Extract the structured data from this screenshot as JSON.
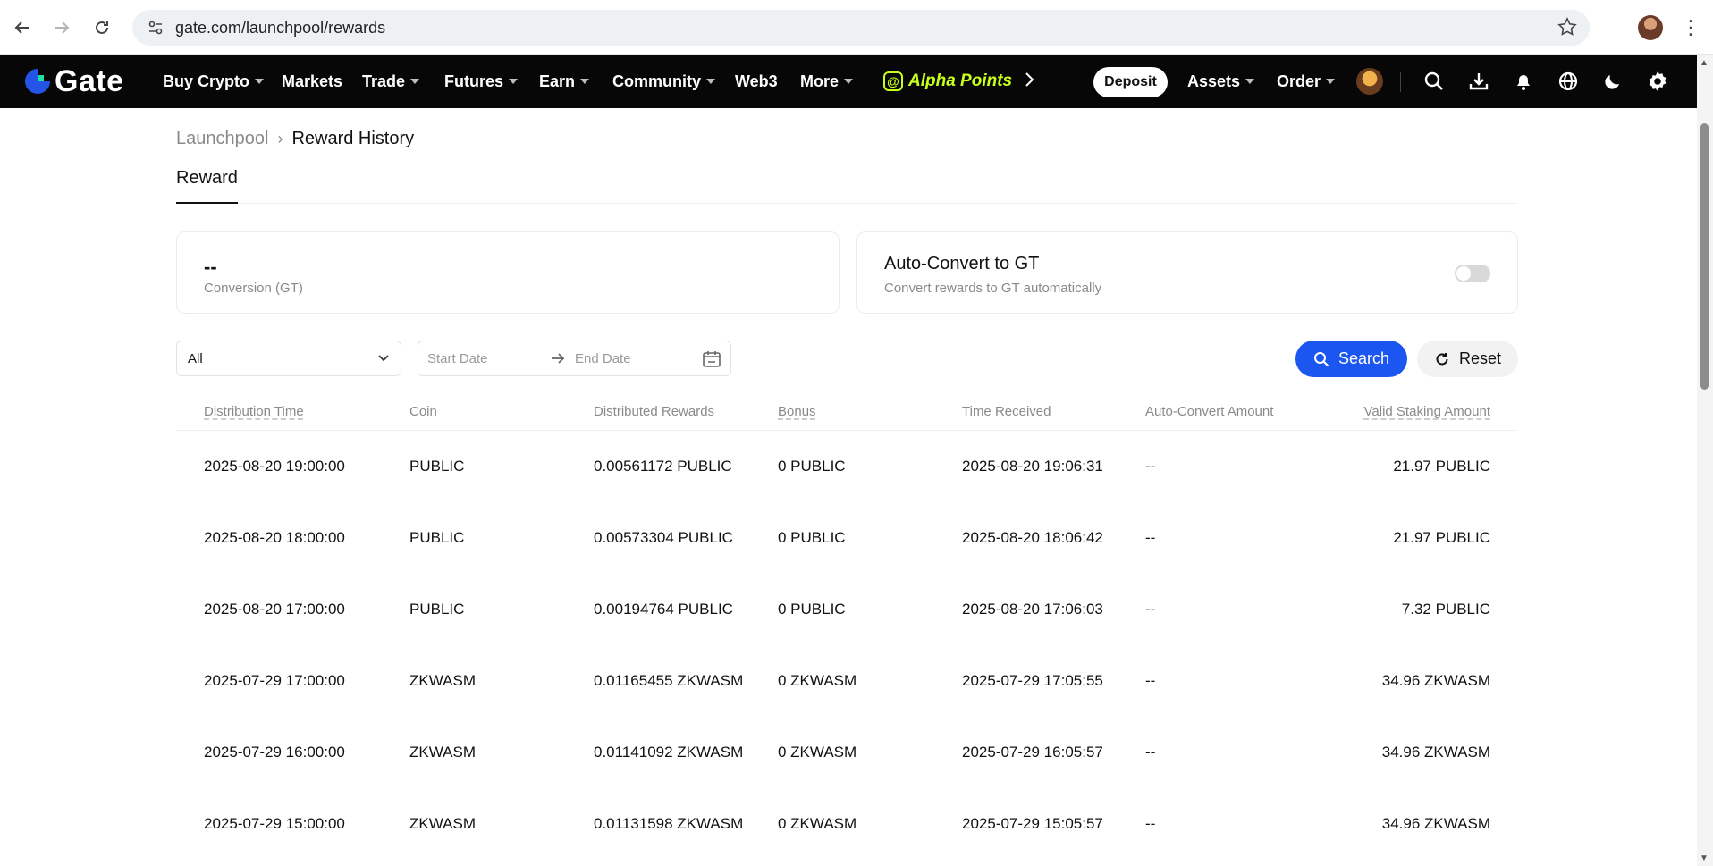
{
  "browser": {
    "url": "gate.com/launchpool/rewards"
  },
  "header": {
    "logo_text": "Gate",
    "nav": [
      {
        "label": "Buy Crypto",
        "caret": true
      },
      {
        "label": "Markets",
        "caret": false
      },
      {
        "label": "Trade",
        "caret": true
      },
      {
        "label": "Futures",
        "caret": true
      },
      {
        "label": "Earn",
        "caret": true
      },
      {
        "label": "Community",
        "caret": true
      },
      {
        "label": "Web3",
        "caret": false
      },
      {
        "label": "More",
        "caret": true
      }
    ],
    "promo_label": "Alpha Points",
    "deposit_label": "Deposit",
    "assets_label": "Assets",
    "order_label": "Order"
  },
  "breadcrumb": {
    "parent": "Launchpool",
    "current": "Reward History"
  },
  "tabs": {
    "reward": "Reward"
  },
  "conversion_card": {
    "value": "--",
    "label": "Conversion (GT)"
  },
  "auto_convert_card": {
    "title": "Auto-Convert to GT",
    "subtitle": "Convert rewards to GT automatically",
    "enabled": false
  },
  "filters": {
    "coin_select_value": "All",
    "start_date_placeholder": "Start Date",
    "end_date_placeholder": "End Date",
    "search_label": "Search",
    "reset_label": "Reset"
  },
  "table": {
    "columns": [
      "Distribution Time",
      "Coin",
      "Distributed Rewards",
      "Bonus",
      "Time Received",
      "Auto-Convert Amount",
      "Valid Staking Amount"
    ],
    "rows": [
      [
        "2025-08-20 19:00:00",
        "PUBLIC",
        "0.00561172 PUBLIC",
        "0 PUBLIC",
        "2025-08-20 19:06:31",
        "--",
        "21.97 PUBLIC"
      ],
      [
        "2025-08-20 18:00:00",
        "PUBLIC",
        "0.00573304 PUBLIC",
        "0 PUBLIC",
        "2025-08-20 18:06:42",
        "--",
        "21.97 PUBLIC"
      ],
      [
        "2025-08-20 17:00:00",
        "PUBLIC",
        "0.00194764 PUBLIC",
        "0 PUBLIC",
        "2025-08-20 17:06:03",
        "--",
        "7.32 PUBLIC"
      ],
      [
        "2025-07-29 17:00:00",
        "ZKWASM",
        "0.01165455 ZKWASM",
        "0 ZKWASM",
        "2025-07-29 17:05:55",
        "--",
        "34.96 ZKWASM"
      ],
      [
        "2025-07-29 16:00:00",
        "ZKWASM",
        "0.01141092 ZKWASM",
        "0 ZKWASM",
        "2025-07-29 16:05:57",
        "--",
        "34.96 ZKWASM"
      ],
      [
        "2025-07-29 15:00:00",
        "ZKWASM",
        "0.01131598 ZKWASM",
        "0 ZKWASM",
        "2025-07-29 15:05:57",
        "--",
        "34.96 ZKWASM"
      ]
    ]
  },
  "colors": {
    "accent_blue": "#1a56ef",
    "header_bg": "#070707",
    "promo_green": "#c6ff1a"
  }
}
